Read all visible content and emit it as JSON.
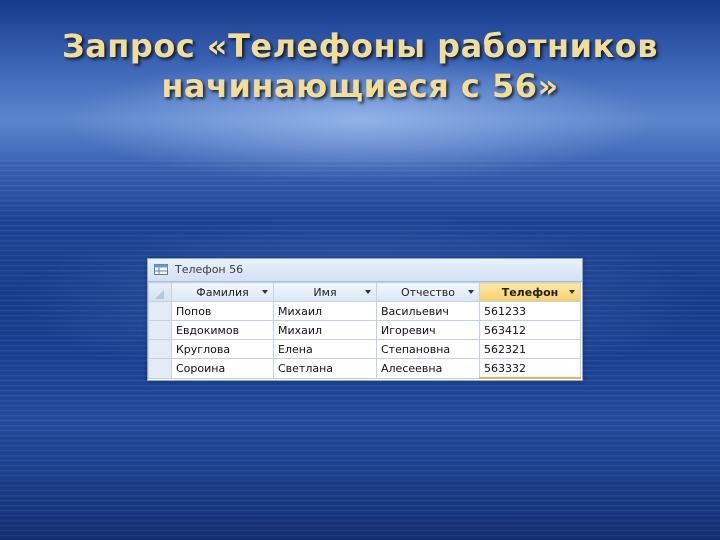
{
  "slide": {
    "title_line1": "Запрос «Телефоны работников",
    "title_line2": "начинающиеся с 56»"
  },
  "query_window": {
    "title": "Телефон 56",
    "icon": "query-icon",
    "columns": [
      "Фамилия",
      "Имя",
      "Отчество",
      "Телефон"
    ],
    "selected_column": "Телефон",
    "rows": [
      [
        "Попов",
        "Михаил",
        "Васильевич",
        "561233"
      ],
      [
        "Евдокимов",
        "Михаил",
        "Игоревич",
        "563412"
      ],
      [
        "Круглова",
        "Елена",
        "Степановна",
        "562321"
      ],
      [
        "Сороина",
        "Светлана",
        "Алесеевна",
        "563332"
      ]
    ]
  },
  "colors": {
    "title_text": "#f1dc9a",
    "selected_header": "#f8cf6a"
  }
}
